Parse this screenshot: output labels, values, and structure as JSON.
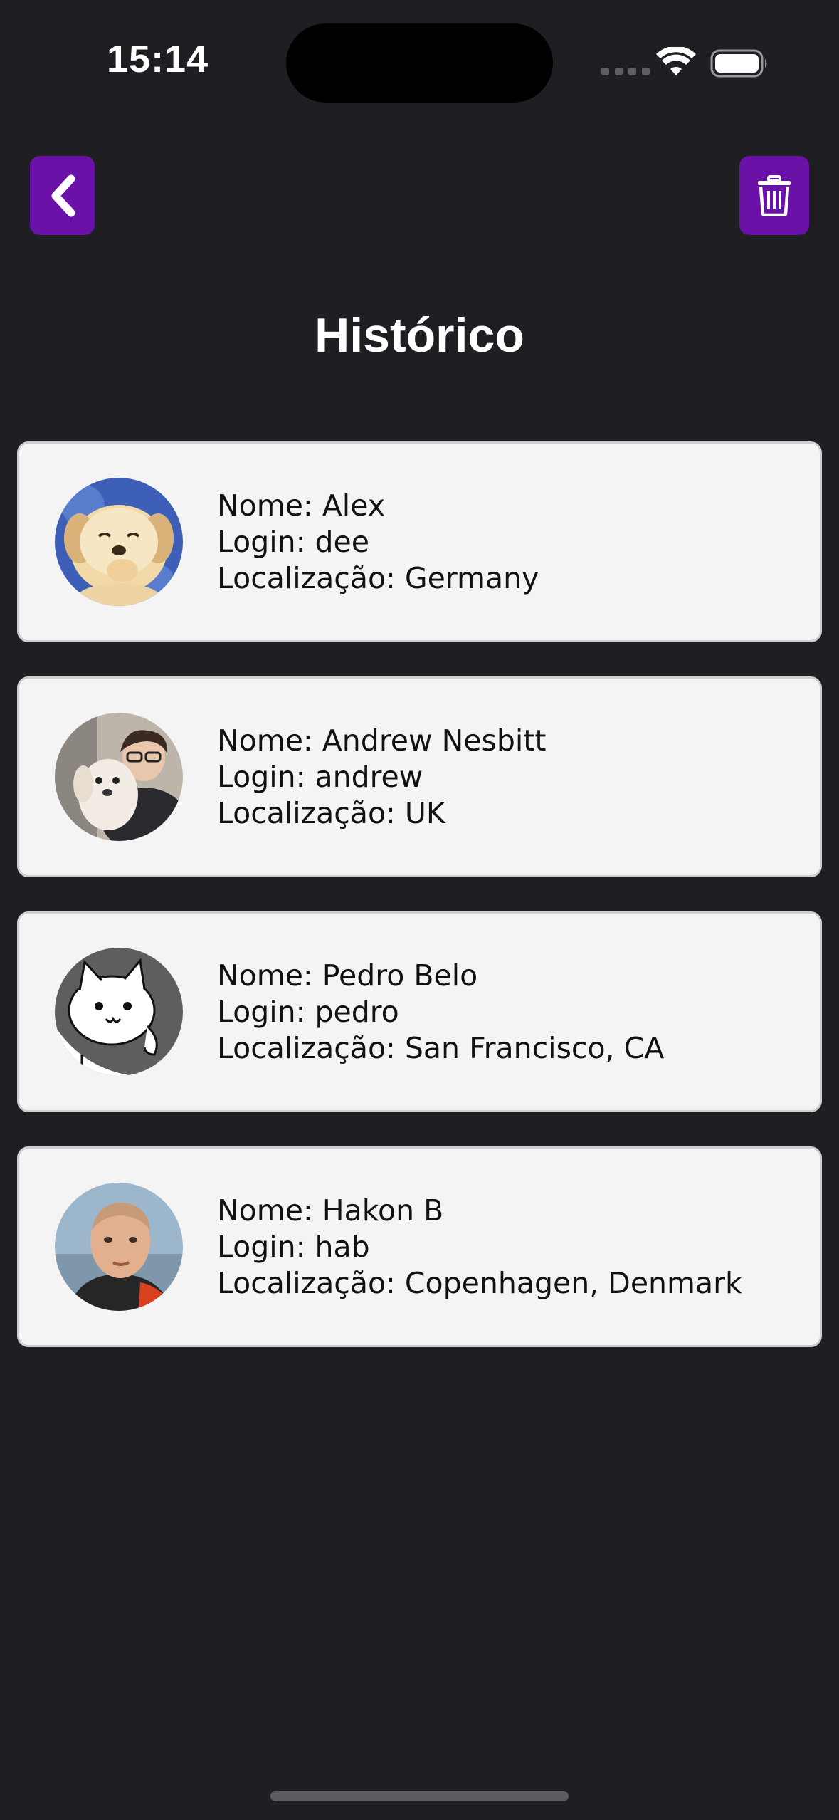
{
  "status_bar": {
    "time": "15:14"
  },
  "header": {
    "back_icon": "chevron-left-icon",
    "trash_icon": "trash-icon",
    "accent_color": "#6a12a8"
  },
  "page": {
    "title": "Histórico"
  },
  "users": [
    {
      "name": "Nome: Alex",
      "login": "Login: dee",
      "location": "Localização: Germany",
      "avatar": "puppy-photo"
    },
    {
      "name": "Nome: Andrew Nesbitt",
      "login": "Login: andrew",
      "location": "Localização: UK",
      "avatar": "man-with-dog-photo"
    },
    {
      "name": "Nome: Pedro Belo",
      "login": "Login: pedro",
      "location": "Localização: San Francisco, CA",
      "avatar": "cartoon-cat"
    },
    {
      "name": "Nome: Hakon B",
      "login": "Login: hab",
      "location": "Localização: Copenhagen, Denmark",
      "avatar": "man-portrait-photo"
    }
  ]
}
